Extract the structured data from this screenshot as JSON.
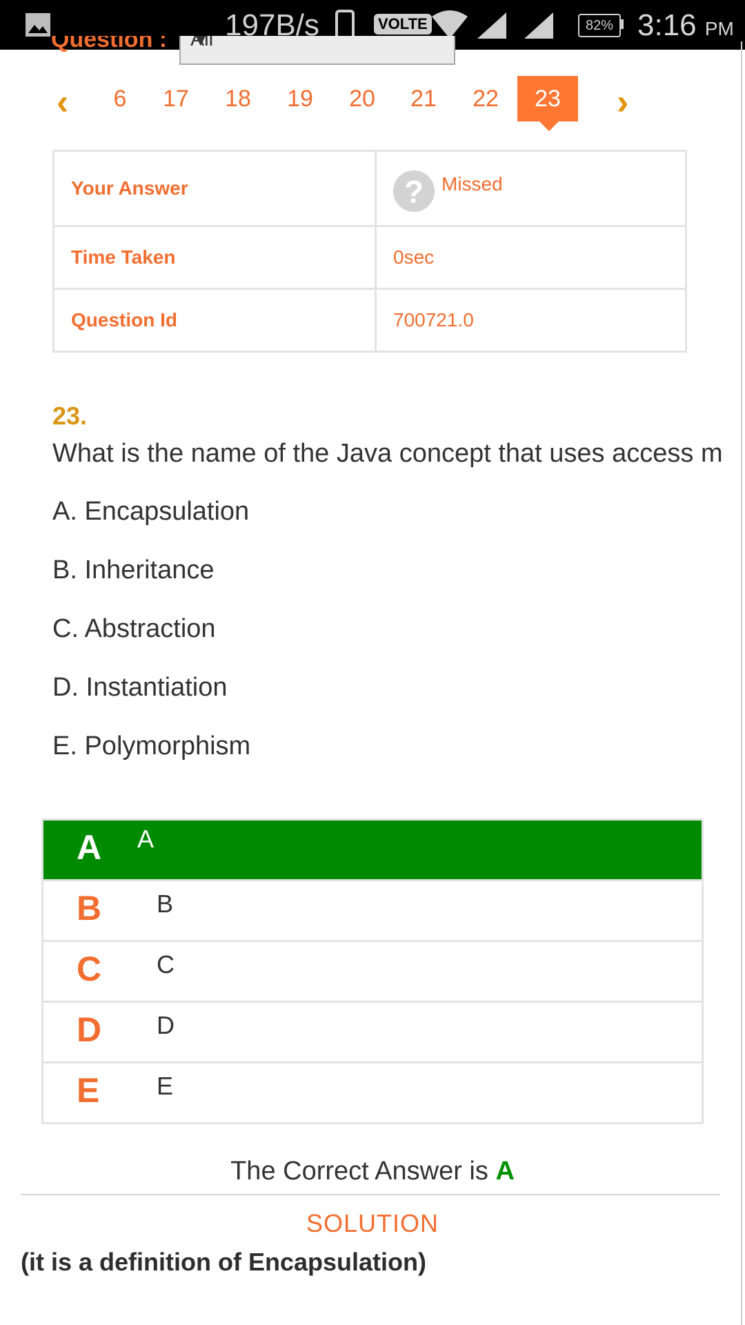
{
  "status_bar": {
    "net_speed": "197B/s",
    "volte": "VOLTE",
    "battery": "82%",
    "time": "3:16",
    "ampm": "PM"
  },
  "filter": {
    "label": "Question :",
    "selected": "All"
  },
  "pager": {
    "pages": [
      "6",
      "17",
      "18",
      "19",
      "20",
      "21",
      "22",
      "23"
    ],
    "active": "23"
  },
  "info": {
    "your_answer_label": "Your Answer",
    "your_answer_value": "Missed",
    "time_taken_label": "Time Taken",
    "time_taken_value": "0sec",
    "question_id_label": "Question Id",
    "question_id_value": "700721.0"
  },
  "question": {
    "number": "23.",
    "text": "What is the name of the Java concept that uses access m",
    "options": [
      "A. Encapsulation",
      "B. Inheritance",
      "C. Abstraction",
      "D. Instantiation",
      "E. Polymorphism"
    ]
  },
  "answers": [
    {
      "letter": "A",
      "text": "A"
    },
    {
      "letter": "B",
      "text": "B"
    },
    {
      "letter": "C",
      "text": "C"
    },
    {
      "letter": "D",
      "text": "D"
    },
    {
      "letter": "E",
      "text": "E"
    }
  ],
  "result": {
    "prefix": "The Correct Answer is ",
    "answer": "A",
    "solution_title": "SOLUTION",
    "solution_text": "(it is a definition of Encapsulation)"
  },
  "colors": {
    "accent": "#f26e30",
    "active_page": "#ff7733",
    "correct": "#008a00",
    "number": "#d99514"
  },
  "icons": {
    "status_left": "gallery-icon",
    "missed": "question-mark-icon",
    "prev": "chevron-left-icon",
    "next": "chevron-right-icon"
  }
}
